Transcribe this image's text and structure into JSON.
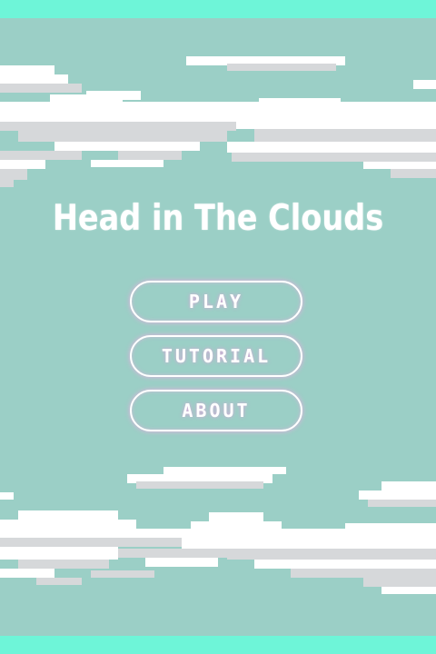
{
  "game": {
    "title": "Head in The Clouds"
  },
  "menu": {
    "play_label": "PLAY",
    "tutorial_label": "TUTORIAL",
    "about_label": "ABOUT"
  },
  "colors": {
    "background": "#9bcfc6",
    "frame_bar": "#6ef5d8",
    "cloud_white": "#ffffff",
    "cloud_shade": "#d6d8da",
    "button_glow": "#eeaae1"
  }
}
